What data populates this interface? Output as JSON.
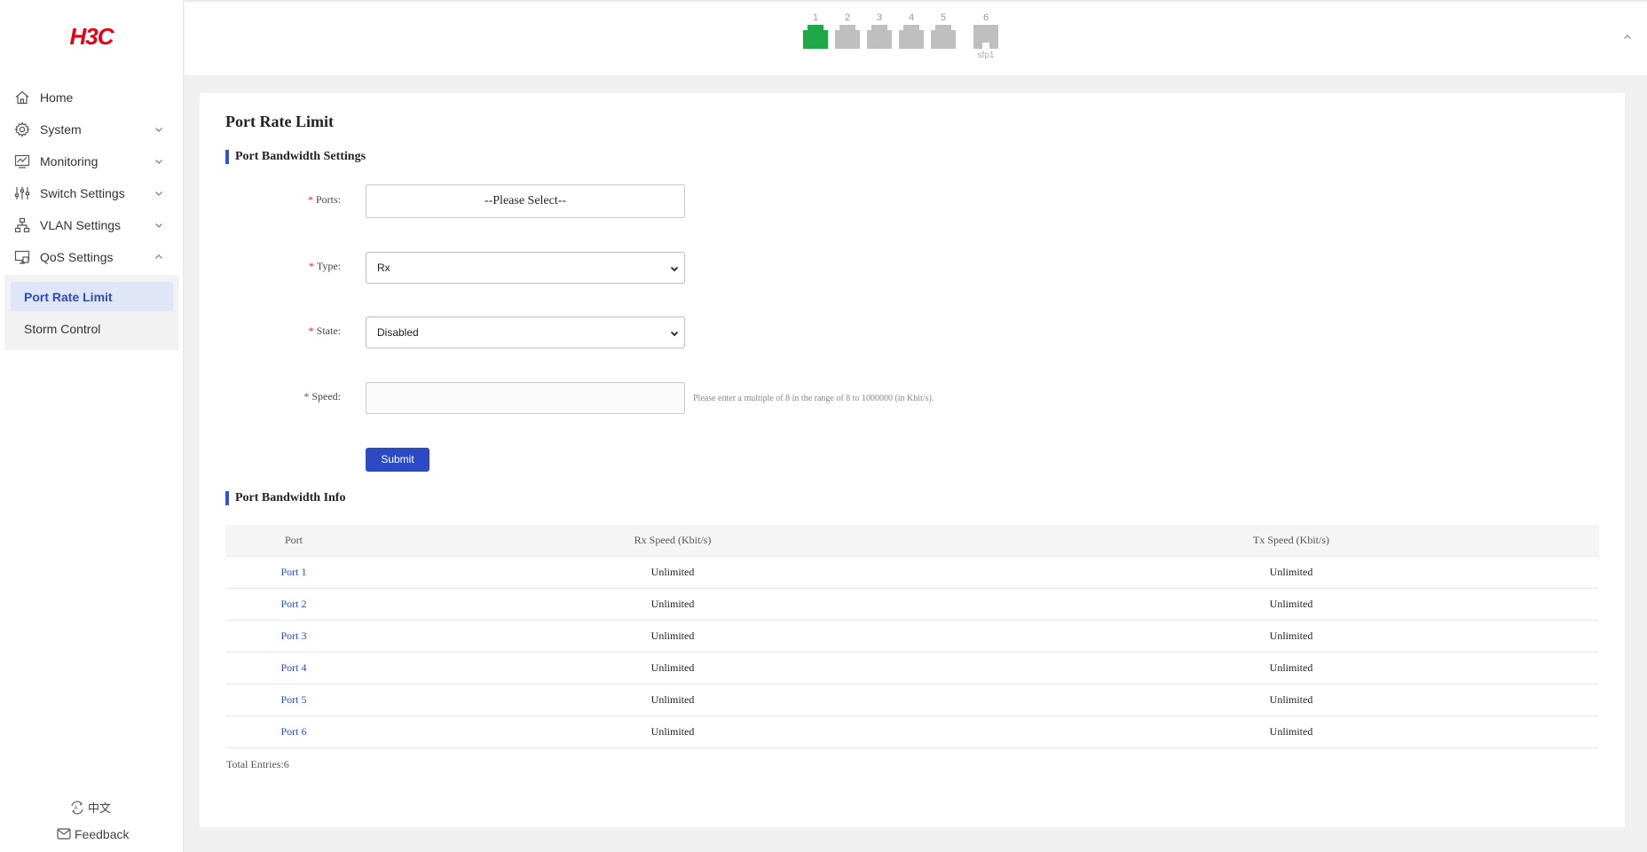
{
  "brand": {
    "logo_text": "H3C",
    "logo_color": "#e60012"
  },
  "sidebar": {
    "items": [
      {
        "label": "Home",
        "icon": "home-icon",
        "expandable": false
      },
      {
        "label": "System",
        "icon": "gear-icon",
        "expandable": true,
        "expanded": false
      },
      {
        "label": "Monitoring",
        "icon": "monitor-chart-icon",
        "expandable": true,
        "expanded": false
      },
      {
        "label": "Switch Settings",
        "icon": "sliders-icon",
        "expandable": true,
        "expanded": false
      },
      {
        "label": "VLAN Settings",
        "icon": "network-icon",
        "expandable": true,
        "expanded": false
      },
      {
        "label": "QoS Settings",
        "icon": "qos-icon",
        "expandable": true,
        "expanded": true
      }
    ],
    "subitems": [
      {
        "label": "Port Rate Limit",
        "active": true
      },
      {
        "label": "Storm Control",
        "active": false
      }
    ],
    "language_label": "中文",
    "feedback_label": "Feedback"
  },
  "topbar": {
    "ports": [
      {
        "number": "1",
        "status": "up",
        "color": "#21a846"
      },
      {
        "number": "2",
        "status": "down",
        "color": "#bfbfbf"
      },
      {
        "number": "3",
        "status": "down",
        "color": "#bfbfbf"
      },
      {
        "number": "4",
        "status": "down",
        "color": "#bfbfbf"
      },
      {
        "number": "5",
        "status": "down",
        "color": "#bfbfbf"
      },
      {
        "number": "6",
        "status": "down",
        "color": "#bfbfbf",
        "sublabel": "sfp1"
      }
    ]
  },
  "page": {
    "title": "Port Rate Limit",
    "settings_section": "Port Bandwidth Settings",
    "info_section": "Port Bandwidth Info",
    "accent_color": "#2f55d4"
  },
  "form": {
    "required_mark": "*",
    "ports_label": "Ports:",
    "ports_value": "--Please Select--",
    "type_label": "Type:",
    "type_value": "Rx",
    "state_label": "State:",
    "state_value": "Disabled",
    "speed_label": "Speed:",
    "speed_value": "",
    "speed_hint": "Please enter a multiple of 8 in the range of 8 to 1000000 (in Kbit/s).",
    "submit_label": "Submit"
  },
  "table": {
    "columns": [
      "Port",
      "Rx Speed (Kbit/s)",
      "Tx Speed (Kbit/s)"
    ],
    "rows": [
      [
        "Port 1",
        "Unlimited",
        "Unlimited"
      ],
      [
        "Port 2",
        "Unlimited",
        "Unlimited"
      ],
      [
        "Port 3",
        "Unlimited",
        "Unlimited"
      ],
      [
        "Port 4",
        "Unlimited",
        "Unlimited"
      ],
      [
        "Port 5",
        "Unlimited",
        "Unlimited"
      ],
      [
        "Port 6",
        "Unlimited",
        "Unlimited"
      ]
    ],
    "total_label": "Total Entries:6"
  }
}
